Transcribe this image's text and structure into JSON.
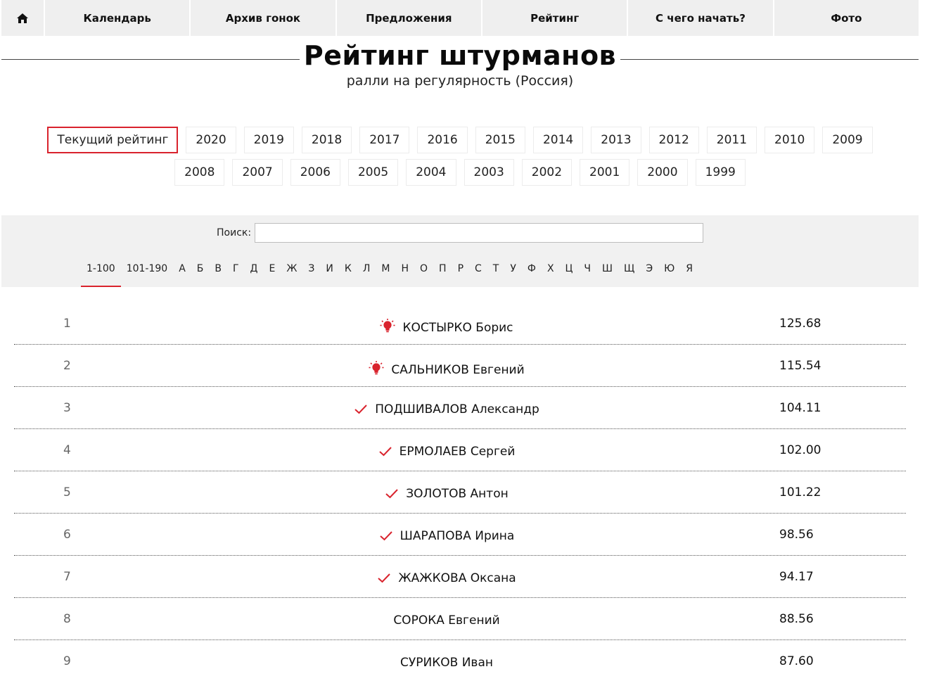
{
  "nav": {
    "home_icon": "home-icon",
    "items": [
      "Календарь",
      "Архив гонок",
      "Предложения",
      "Рейтинг",
      "С чего начать?",
      "Фото"
    ]
  },
  "page": {
    "title": "Рейтинг штурманов",
    "subtitle": "ралли на регулярность (Россия)"
  },
  "years": {
    "row1": [
      "Текущий рейтинг",
      "2020",
      "2019",
      "2018",
      "2017",
      "2016",
      "2015",
      "2014",
      "2013",
      "2012",
      "2011",
      "2010",
      "2009"
    ],
    "row2": [
      "2008",
      "2007",
      "2006",
      "2005",
      "2004",
      "2003",
      "2002",
      "2001",
      "2000",
      "1999"
    ],
    "active": "Текущий рейтинг"
  },
  "search": {
    "label": "Поиск:",
    "value": ""
  },
  "letters": {
    "items": [
      "1-100",
      "101-190",
      "А",
      "Б",
      "В",
      "Г",
      "Д",
      "Е",
      "Ж",
      "З",
      "И",
      "К",
      "Л",
      "М",
      "Н",
      "О",
      "П",
      "Р",
      "С",
      "Т",
      "У",
      "Ф",
      "Х",
      "Ц",
      "Ч",
      "Ш",
      "Щ",
      "Э",
      "Ю",
      "Я"
    ],
    "active": "1-100"
  },
  "colors": {
    "accent": "#d9232d"
  },
  "ranking": [
    {
      "pos": "1",
      "name": "КОСТЫРКО Борис",
      "score": "125.68",
      "icon": "lightbulb-icon"
    },
    {
      "pos": "2",
      "name": "САЛЬНИКОВ Евгений",
      "score": "115.54",
      "icon": "lightbulb-icon"
    },
    {
      "pos": "3",
      "name": "ПОДШИВАЛОВ Александр",
      "score": "104.11",
      "icon": "checkmark-icon"
    },
    {
      "pos": "4",
      "name": "ЕРМОЛАЕВ Сергей",
      "score": "102.00",
      "icon": "checkmark-icon"
    },
    {
      "pos": "5",
      "name": "ЗОЛОТОВ Антон",
      "score": "101.22",
      "icon": "checkmark-icon"
    },
    {
      "pos": "6",
      "name": "ШАРАПОВА Ирина",
      "score": "98.56",
      "icon": "checkmark-icon"
    },
    {
      "pos": "7",
      "name": "ЖАЖКОВА Оксана",
      "score": "94.17",
      "icon": "checkmark-icon"
    },
    {
      "pos": "8",
      "name": "СОРОКА Евгений",
      "score": "88.56",
      "icon": ""
    },
    {
      "pos": "9",
      "name": "СУРИКОВ Иван",
      "score": "87.60",
      "icon": ""
    }
  ]
}
